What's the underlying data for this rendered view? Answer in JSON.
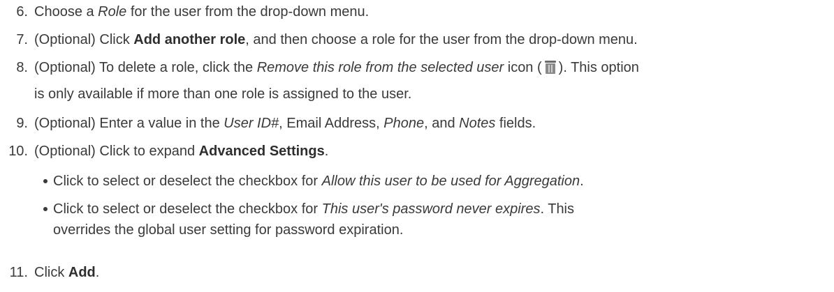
{
  "steps": [
    {
      "num": "6.",
      "t1": "Choose a ",
      "i1": "Role",
      "t2": " for the user from the drop-down menu."
    },
    {
      "num": "7.",
      "t1": "(Optional) Click ",
      "b1": "Add another role",
      "t2": ", and then choose a role for the user from the drop-down menu."
    },
    {
      "num": "8.",
      "t1": "(Optional) To delete a role, click the ",
      "i1": "Remove this role from the selected user",
      "t2": " icon (",
      "t3": "). This option",
      "cont": "is only available if more than one role is assigned to the user.",
      "icon": "trash-icon"
    },
    {
      "num": "9.",
      "t1": "(Optional) Enter a value in the ",
      "i1": "User ID#",
      "t2": ", Email Address, ",
      "i2": "Phone",
      "t3": ", and ",
      "i3": "Notes",
      "t4": " fields."
    },
    {
      "num": "10.",
      "t1": "(Optional) Click to expand ",
      "b1": "Advanced Settings",
      "t2": "."
    },
    {
      "num": "11.",
      "t1": "Click ",
      "b1": "Add",
      "t2": "."
    }
  ],
  "bullets": [
    {
      "t1": "Click to select or deselect the checkbox for ",
      "i1": "Allow this user to be used for Aggregation",
      "t2": "."
    },
    {
      "t1": "Click to select or deselect the checkbox for ",
      "i1": "This user's password never expires",
      "t2": ". This",
      "cont": "overrides the global user setting for password expiration."
    }
  ]
}
